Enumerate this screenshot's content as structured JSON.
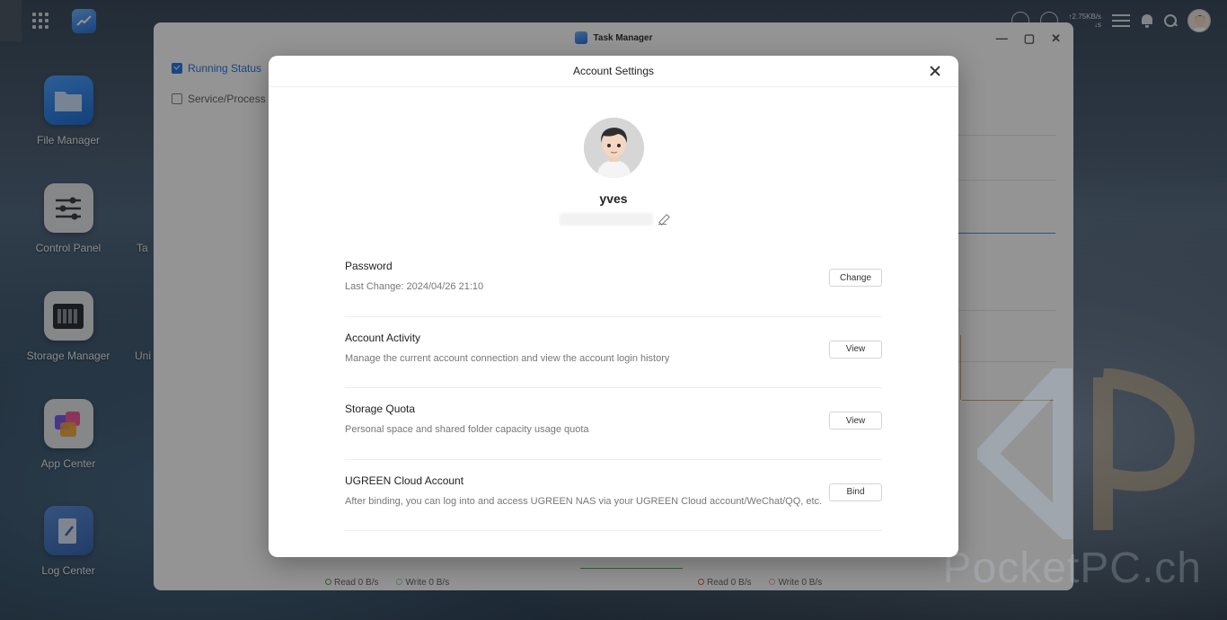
{
  "desktop": {
    "icons": [
      {
        "label": "File Manager"
      },
      {
        "label": "Control Panel"
      },
      {
        "label": "Storage Manager"
      },
      {
        "label": "App Center"
      },
      {
        "label": "Log Center"
      }
    ],
    "partial_labels": [
      "Ta",
      "Uni"
    ]
  },
  "topbar": {
    "speed_up": "↑2.75KB/s",
    "speed_down": "↓s"
  },
  "task_manager": {
    "title": "Task Manager",
    "sidebar": [
      {
        "label": "Running Status"
      },
      {
        "label": "Service/Process"
      }
    ],
    "legend_left": {
      "read": "Read 0 B/s",
      "write": "Write 0 B/s"
    },
    "legend_right": {
      "read": "Read 0 B/s",
      "write": "Write 0 B/s"
    }
  },
  "watermark": "PocketPC.ch",
  "modal": {
    "title": "Account Settings",
    "username": "yves",
    "settings": [
      {
        "title": "Password",
        "description": "Last Change:  2024/04/26 21:10",
        "button": "Change"
      },
      {
        "title": "Account Activity",
        "description": "Manage the current account connection and view the account login history",
        "button": "View"
      },
      {
        "title": "Storage Quota",
        "description": "Personal space and shared folder capacity usage quota",
        "button": "View"
      },
      {
        "title": "UGREEN Cloud Account",
        "description": "After binding, you can log into and access UGREEN NAS via your UGREEN Cloud account/WeChat/QQ, etc.",
        "button": "Bind"
      }
    ]
  }
}
